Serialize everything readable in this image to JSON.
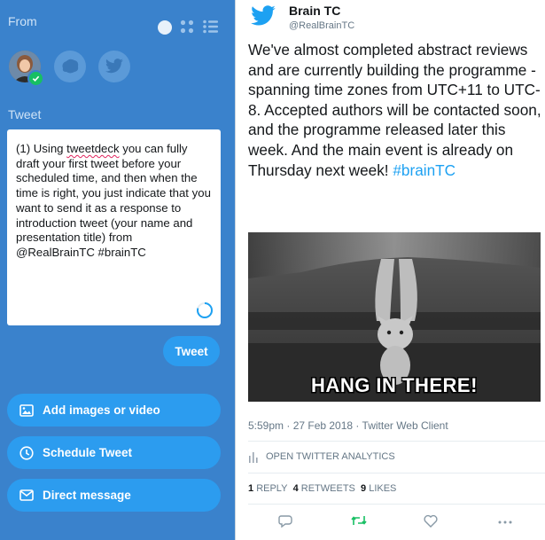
{
  "left": {
    "from_label": "From",
    "tweet_label": "Tweet",
    "compose_prefix": "(1)  Using ",
    "compose_misspelled": "tweetdeck",
    "compose_rest": " you can fully draft your first tweet before your scheduled time, and then when the time is right, you just indicate that you want to send it as a response to introduction tweet (your name and presentation title) from @RealBrainTC #brainTC",
    "tweet_button": "Tweet",
    "add_images": "Add images or video",
    "schedule": "Schedule Tweet",
    "direct_message": "Direct message"
  },
  "tweet": {
    "author": "Brain TC",
    "handle": "@RealBrainTC",
    "text": "We've almost completed abstract reviews and are currently building the programme - spanning time zones from UTC+11 to UTC-8. Accepted authors will be contacted soon, and the programme released later this week. And the main event is already on Thursday next week! ",
    "hashtag": "#brainTC",
    "media_caption": "HANG IN THERE!",
    "timestamp": "5:59pm · 27 Feb 2018 · Twitter Web Client",
    "analytics": "OPEN TWITTER ANALYTICS",
    "replies_count": "1",
    "replies_label": "REPLY",
    "retweets_count": "4",
    "retweets_label": "RETWEETS",
    "likes_count": "9",
    "likes_label": "LIKES"
  },
  "colors": {
    "panel": "#3a82cc",
    "button": "#2c9cef",
    "link": "#1da1f2",
    "retweet": "#17bf63"
  }
}
